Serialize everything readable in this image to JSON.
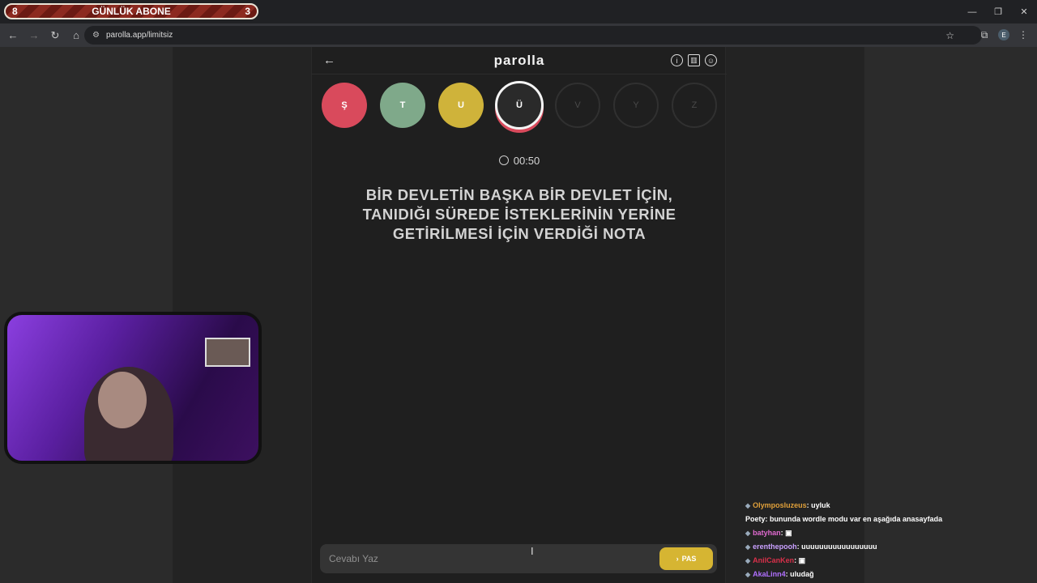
{
  "overlay": {
    "left_num": "8",
    "label": "GÜNLÜK ABONE",
    "right_num": "3"
  },
  "browser": {
    "url": "parolla.app/limitsiz",
    "back_icon": "arrow-left-icon",
    "forward_icon": "arrow-right-icon",
    "reload_icon": "reload-icon",
    "home_icon": "home-icon",
    "profile_initial": "E"
  },
  "app": {
    "logo": "parolla",
    "letters": [
      {
        "char": "Ş",
        "state": "wrong"
      },
      {
        "char": "T",
        "state": "correct"
      },
      {
        "char": "U",
        "state": "passed"
      },
      {
        "char": "Ü",
        "state": "active"
      },
      {
        "char": "V",
        "state": "empty"
      },
      {
        "char": "Y",
        "state": "empty"
      },
      {
        "char": "Z",
        "state": "empty"
      }
    ],
    "timer": "00:50",
    "question": "BİR DEVLETİN BAŞKA BİR DEVLET İÇİN, TANIDIĞI SÜREDE İSTEKLERİNİN YERİNE GETİRİLMESİ İÇİN VERDİĞİ NOTA",
    "input_placeholder": "Cevabı Yaz",
    "pass_label": "PAS"
  },
  "chat": [
    {
      "user": "Olymposluzeus",
      "color": "#e0a03a",
      "message": "uyluk"
    },
    {
      "user": "Poety",
      "color": "#ffffff",
      "message": "bununda wordle modu var en aşağıda anasayfada"
    },
    {
      "user": "batyhan",
      "color": "#e06ad0",
      "message": "▣"
    },
    {
      "user": "erenthepooh",
      "color": "#c9a0ff",
      "message": "uuuuuuuuuuuuuuuuu"
    },
    {
      "user": "AnilCanKen",
      "color": "#d9304a",
      "message": "▣"
    },
    {
      "user": "AkaLinn4",
      "color": "#b070ff",
      "message": "uludağ"
    }
  ]
}
